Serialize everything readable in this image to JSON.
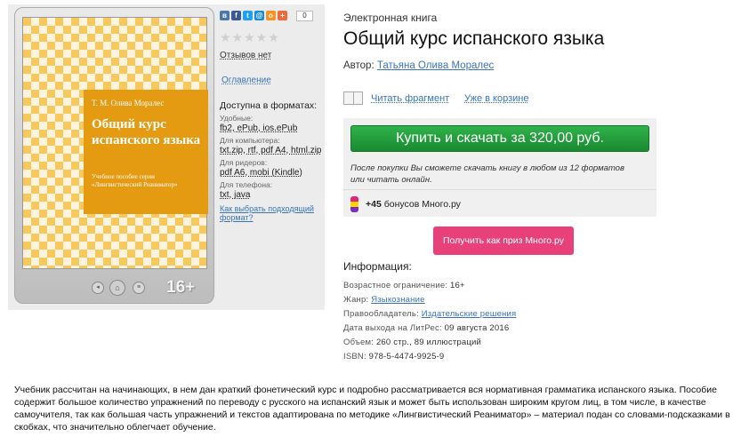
{
  "cover": {
    "author": "Т. М. Олива Моралес",
    "title": "Общий курс испанского языка",
    "series": "Учебное пособие серии «Лингвистический Реаниматор»",
    "age_badge": "16+"
  },
  "share": {
    "icons": [
      "vk-icon",
      "facebook-icon",
      "twitter-icon",
      "odnoklassniki-icon",
      "mailru-icon",
      "plus-icon"
    ],
    "count": "0"
  },
  "stars": "★★★★★",
  "reviews_label": "Отзывов нет",
  "toc_label": "Оглавление",
  "formats": {
    "heading": "Доступна в форматах:",
    "groups": [
      {
        "label": "Удобные:",
        "items": "fb2, ePub, ios.ePub"
      },
      {
        "label": "Для компьютера:",
        "items": "txt.zip, rtf, pdf A4, html.zip"
      },
      {
        "label": "Для ридеров:",
        "items": "pdf A6, mobi (Kindle)"
      },
      {
        "label": "Для телефона:",
        "items": "txt, java"
      }
    ],
    "pick_link": "Как выбрать подходящий формат?"
  },
  "book": {
    "type": "Электронная книга",
    "title": "Общий курс испанского языка",
    "author_label": "Автор:",
    "author_name": "Татьяна Олива Моралес"
  },
  "actions": {
    "read_fragment": "Читать фрагмент",
    "in_cart": "Уже в корзине"
  },
  "buy": {
    "button": "Купить и скачать за 320,00 руб.",
    "note": "После покупки Вы сможете скачать книгу в любом из 12 форматов или читать онлайн.",
    "bonus_amount": "+45",
    "bonus_text": "бонусов Много.ру"
  },
  "prize_button": "Получить как приз Много.ру",
  "info": {
    "heading": "Информация:",
    "age_label": "Возрастное ограничение:",
    "age_value": "16+",
    "genre_label": "Жанр:",
    "genre_value": "Языкознание",
    "rights_label": "Правообладатель:",
    "rights_value": "Издательские решения",
    "release_label": "Дата выхода на ЛитРес:",
    "release_value": "09 августа 2016",
    "volume_label": "Объем:",
    "volume_value": "260 стр., 89 иллюстраций",
    "isbn_label": "ISBN:",
    "isbn_value": "978-5-4474-9925-9"
  },
  "description": "Учебник рассчитан на начинающих, в нем дан краткий фонетический курс и подробно рассматривается вся нормативная грамматика испанского языка. Пособие содержит большое количество упражнений по переводу с русского на испанский язык и может быть использован широким кругом лиц, в том числе, в качестве самоучителя, так как большая часть упражнений и текстов адаптирована по методике «Лингвистический Реаниматор» – материал подан со словами-подсказками в скобках, что значительно облегчает обучение."
}
